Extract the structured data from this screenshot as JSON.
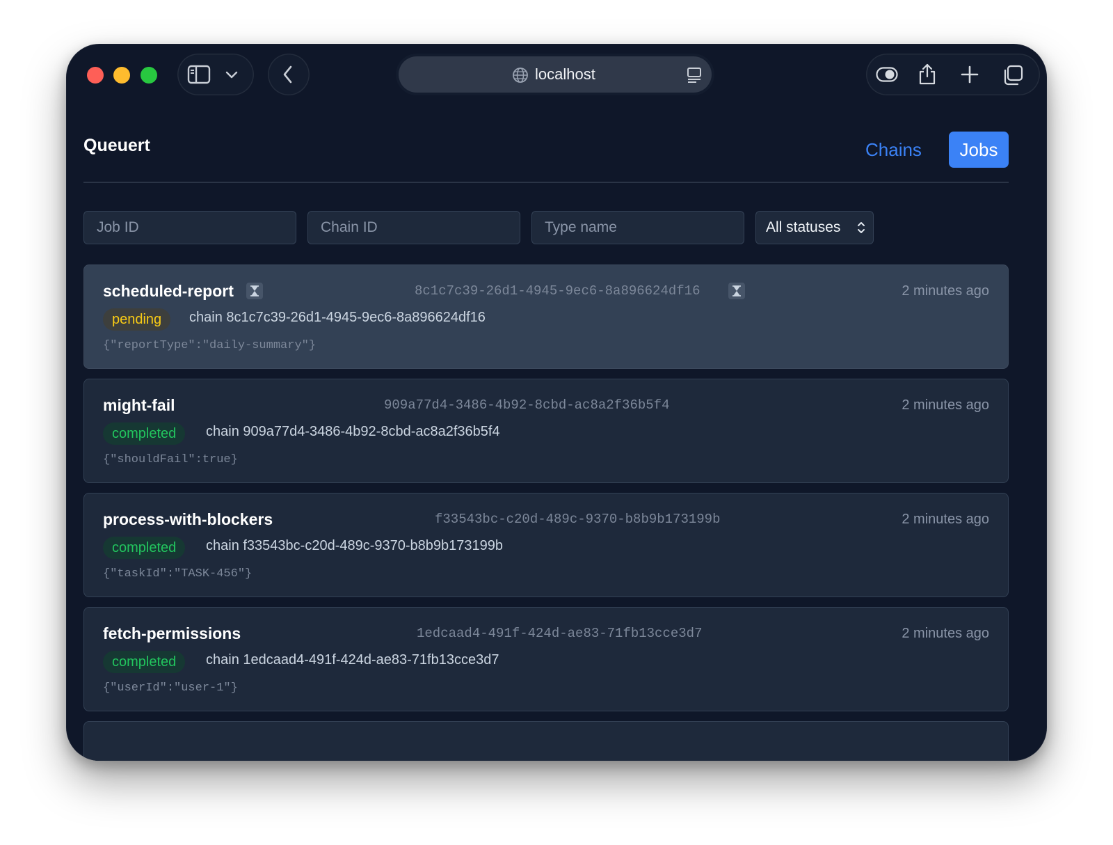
{
  "browser": {
    "url": "localhost"
  },
  "app": {
    "title": "Queuert",
    "nav": {
      "chains": "Chains",
      "jobs": "Jobs"
    }
  },
  "filters": {
    "job_id_placeholder": "Job ID",
    "chain_id_placeholder": "Chain ID",
    "type_name_placeholder": "Type name",
    "status_selected": "All statuses"
  },
  "colors": {
    "accent": "#3b82f6",
    "pending": "#facc15",
    "completed": "#22c55e",
    "background": "#0f1729"
  },
  "jobs": [
    {
      "type": "scheduled-report",
      "id": "8c1c7c39-26d1-4945-9ec6-8a896624df16",
      "status": "pending",
      "chain": "chain 8c1c7c39-26d1-4945-9ec6-8a896624df16",
      "payload": "{\"reportType\":\"daily-summary\"}",
      "time": "2 minutes ago",
      "scheduled_icon": "hourglass-icon"
    },
    {
      "type": "might-fail",
      "id": "909a77d4-3486-4b92-8cbd-ac8a2f36b5f4",
      "status": "completed",
      "chain": "chain 909a77d4-3486-4b92-8cbd-ac8a2f36b5f4",
      "payload": "{\"shouldFail\":true}",
      "time": "2 minutes ago"
    },
    {
      "type": "process-with-blockers",
      "id": "f33543bc-c20d-489c-9370-b8b9b173199b",
      "status": "completed",
      "chain": "chain f33543bc-c20d-489c-9370-b8b9b173199b",
      "payload": "{\"taskId\":\"TASK-456\"}",
      "time": "2 minutes ago"
    },
    {
      "type": "fetch-permissions",
      "id": "1edcaad4-491f-424d-ae83-71fb13cce3d7",
      "status": "completed",
      "chain": "chain 1edcaad4-491f-424d-ae83-71fb13cce3d7",
      "payload": "{\"userId\":\"user-1\"}",
      "time": "2 minutes ago"
    }
  ]
}
